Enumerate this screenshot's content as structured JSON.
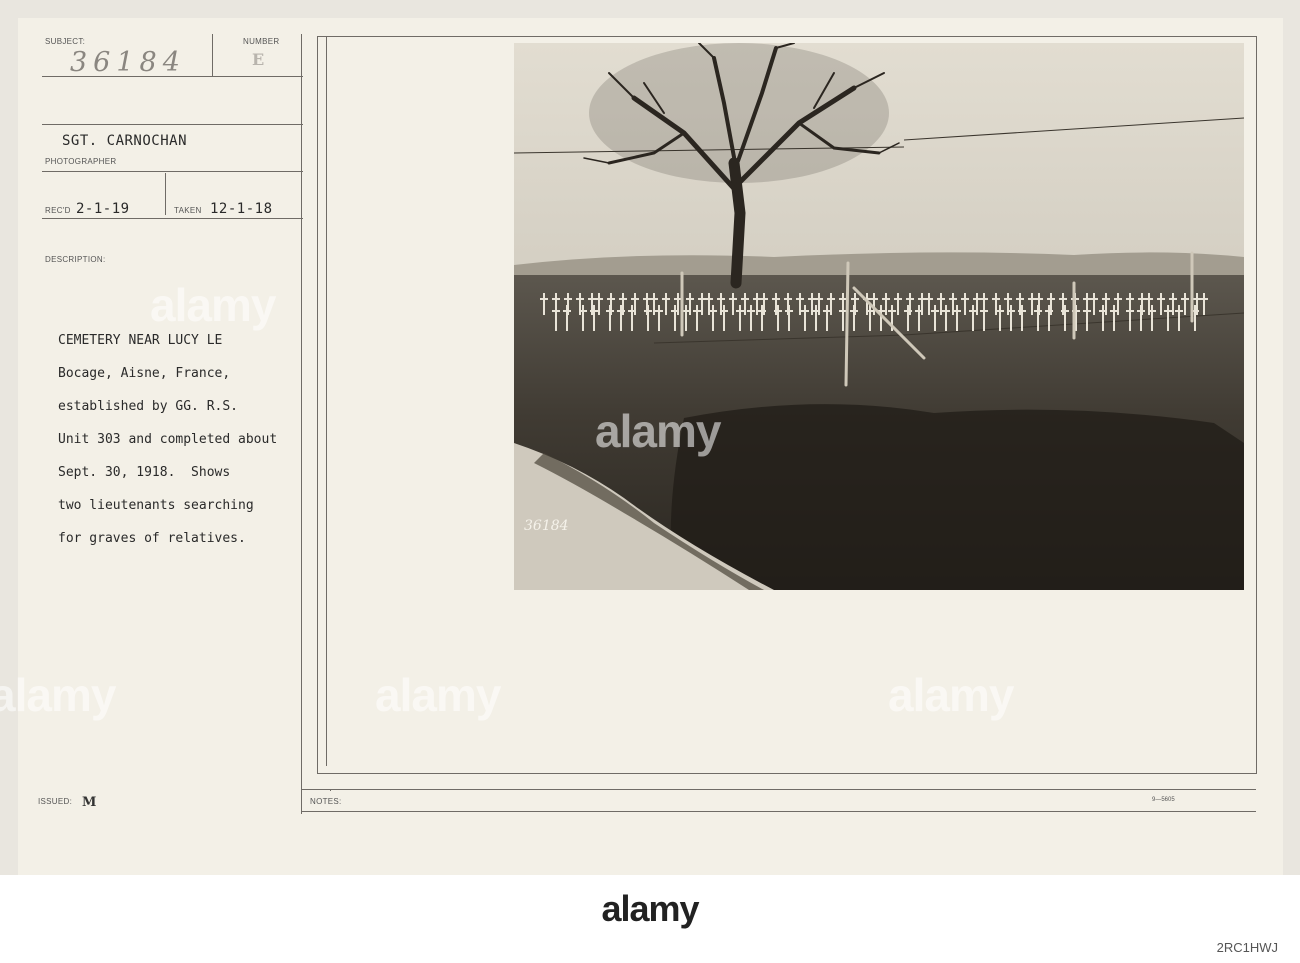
{
  "card": {
    "subject_label": "SUBJECT:",
    "number_label": "NUMBER",
    "subject_number": "36184",
    "number_mark": "E",
    "photographer_name": "SGT. CARNOCHAN",
    "photographer_label": "PHOTOGRAPHER",
    "recd_label": "REC'D",
    "recd_date": "2-1-19",
    "taken_label": "TAKEN",
    "taken_date": "12-1-18",
    "description_label": "DESCRIPTION:",
    "description_lines": [
      "CEMETERY NEAR LUCY LE",
      "Bocage, Aisne, France,",
      "established by GG. R.S.",
      "Unit 303 and completed about",
      "Sept. 30, 1918.  Shows",
      "two lieutenants searching",
      "for graves of relatives."
    ],
    "issued_label": "ISSUED:",
    "issued_value": "M",
    "notes_label": "NOTES:",
    "form_code": "9—5605"
  },
  "photo": {
    "inscription": "36184"
  },
  "watermark": {
    "brand": "alamy",
    "image_id": "2RC1HWJ"
  }
}
